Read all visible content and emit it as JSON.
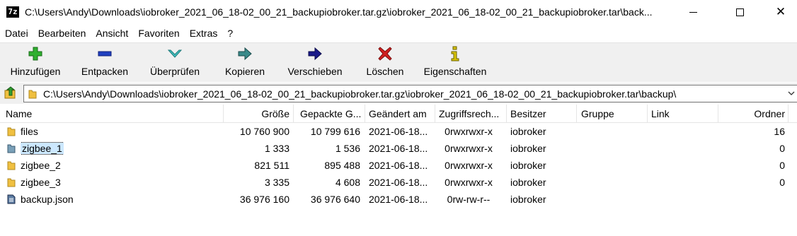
{
  "window": {
    "app_icon_text": "7z",
    "title": "C:\\Users\\Andy\\Downloads\\iobroker_2021_06_18-02_00_21_backupiobroker.tar.gz\\iobroker_2021_06_18-02_00_21_backupiobroker.tar\\back...",
    "close_glyph": "✕"
  },
  "menu": [
    "Datei",
    "Bearbeiten",
    "Ansicht",
    "Favoriten",
    "Extras",
    "?"
  ],
  "toolbar": [
    {
      "label": "Hinzufügen",
      "icon": "plus-icon",
      "color": "#2fb02f"
    },
    {
      "label": "Entpacken",
      "icon": "minus-icon",
      "color": "#2040c0"
    },
    {
      "label": "Überprüfen",
      "icon": "check-icon",
      "color": "#40c0c0"
    },
    {
      "label": "Kopieren",
      "icon": "copy-arrow-icon",
      "color": "#3a8a8a"
    },
    {
      "label": "Verschieben",
      "icon": "move-arrow-icon",
      "color": "#1a1a8a"
    },
    {
      "label": "Löschen",
      "icon": "delete-x-icon",
      "color": "#d02020"
    },
    {
      "label": "Eigenschaften",
      "icon": "info-icon",
      "color": "#c0b000"
    }
  ],
  "address": {
    "path": "C:\\Users\\Andy\\Downloads\\iobroker_2021_06_18-02_00_21_backupiobroker.tar.gz\\iobroker_2021_06_18-02_00_21_backupiobroker.tar\\backup\\"
  },
  "columns": [
    "Name",
    "Größe",
    "Gepackte G...",
    "Geändert am",
    "Zugriffsrech...",
    "Besitzer",
    "Gruppe",
    "Link",
    "Ordner"
  ],
  "rows": [
    {
      "name": "files",
      "type": "folder",
      "size": "10 760 900",
      "packed": "10 799 616",
      "modified": "2021-06-18...",
      "perms": "0rwxrwxr-x",
      "owner": "iobroker",
      "group": "",
      "link": "",
      "folders": "16",
      "selected": false
    },
    {
      "name": "zigbee_1",
      "type": "folder-selected",
      "size": "1 333",
      "packed": "1 536",
      "modified": "2021-06-18...",
      "perms": "0rwxrwxr-x",
      "owner": "iobroker",
      "group": "",
      "link": "",
      "folders": "0",
      "selected": true
    },
    {
      "name": "zigbee_2",
      "type": "folder",
      "size": "821 511",
      "packed": "895 488",
      "modified": "2021-06-18...",
      "perms": "0rwxrwxr-x",
      "owner": "iobroker",
      "group": "",
      "link": "",
      "folders": "0",
      "selected": false
    },
    {
      "name": "zigbee_3",
      "type": "folder",
      "size": "3 335",
      "packed": "4 608",
      "modified": "2021-06-18...",
      "perms": "0rwxrwxr-x",
      "owner": "iobroker",
      "group": "",
      "link": "",
      "folders": "0",
      "selected": false
    },
    {
      "name": "backup.json",
      "type": "file",
      "size": "36 976 160",
      "packed": "36 976 640",
      "modified": "2021-06-18...",
      "perms": "0rw-rw-r--",
      "owner": "iobroker",
      "group": "",
      "link": "",
      "folders": "",
      "selected": false
    }
  ]
}
